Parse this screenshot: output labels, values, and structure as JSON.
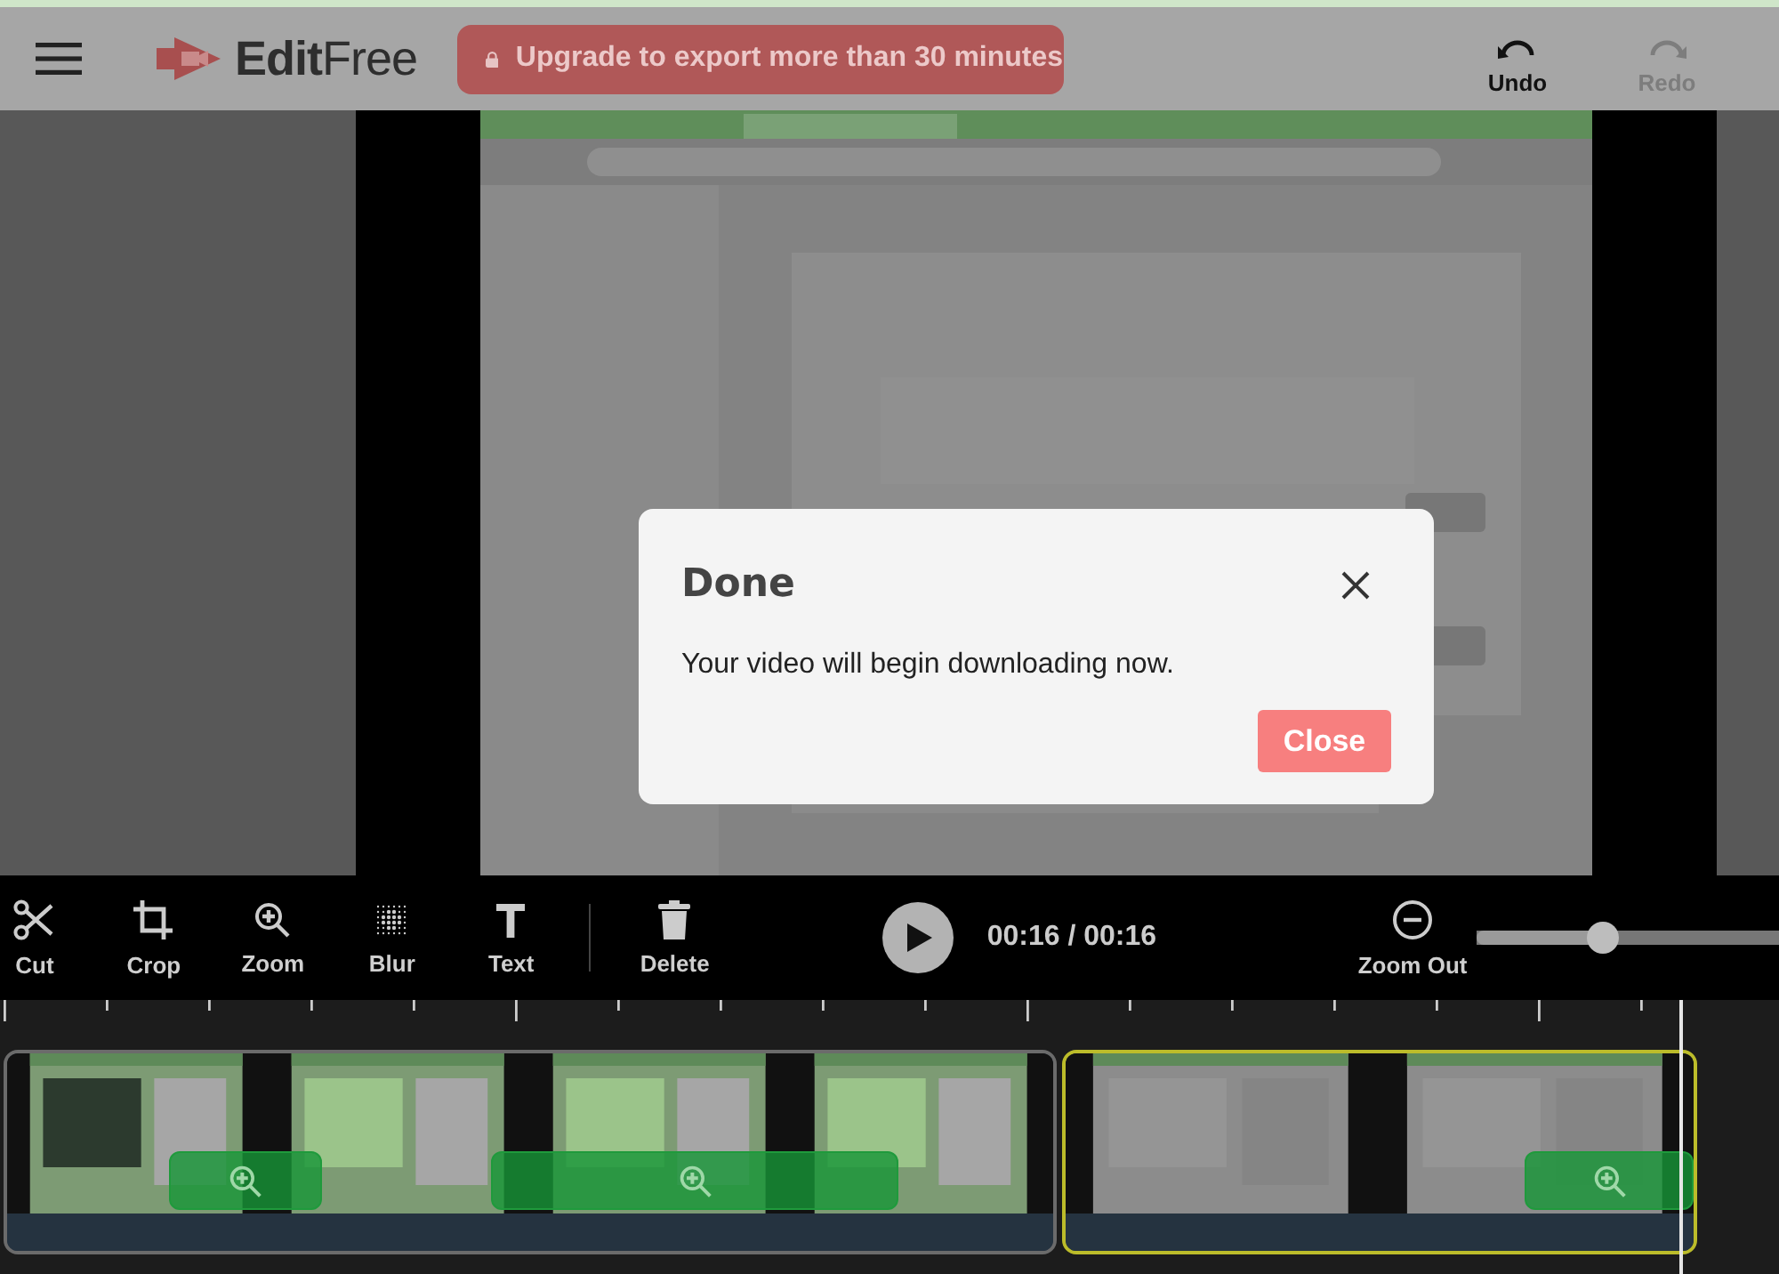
{
  "logo": {
    "text": "**Edit**Free"
  },
  "upgrade_button": {
    "label": "Upgrade to export more than 30 minutes"
  },
  "history": [
    {
      "kind": "undo",
      "label": "Undo",
      "disabled": false
    },
    {
      "kind": "redo",
      "label": "Redo",
      "disabled": true
    }
  ],
  "dialog": {
    "title": "Done",
    "message": "Your video will begin downloading now.",
    "button": "Close"
  },
  "tools": [
    {
      "kind": "cut",
      "label": "Cut"
    },
    {
      "kind": "crop",
      "label": "Crop"
    },
    {
      "kind": "zoom",
      "label": "Zoom"
    },
    {
      "kind": "blur",
      "label": "Blur"
    },
    {
      "kind": "text",
      "label": "Text"
    },
    {
      "kind": "delete",
      "label": "Delete"
    }
  ],
  "playback": {
    "playing": false,
    "time": "00:16 / 00:16"
  },
  "zoom": {
    "label": "Zoom Out",
    "level": 0.42
  },
  "clips": [
    {
      "selected": false
    },
    {
      "selected": true
    }
  ]
}
